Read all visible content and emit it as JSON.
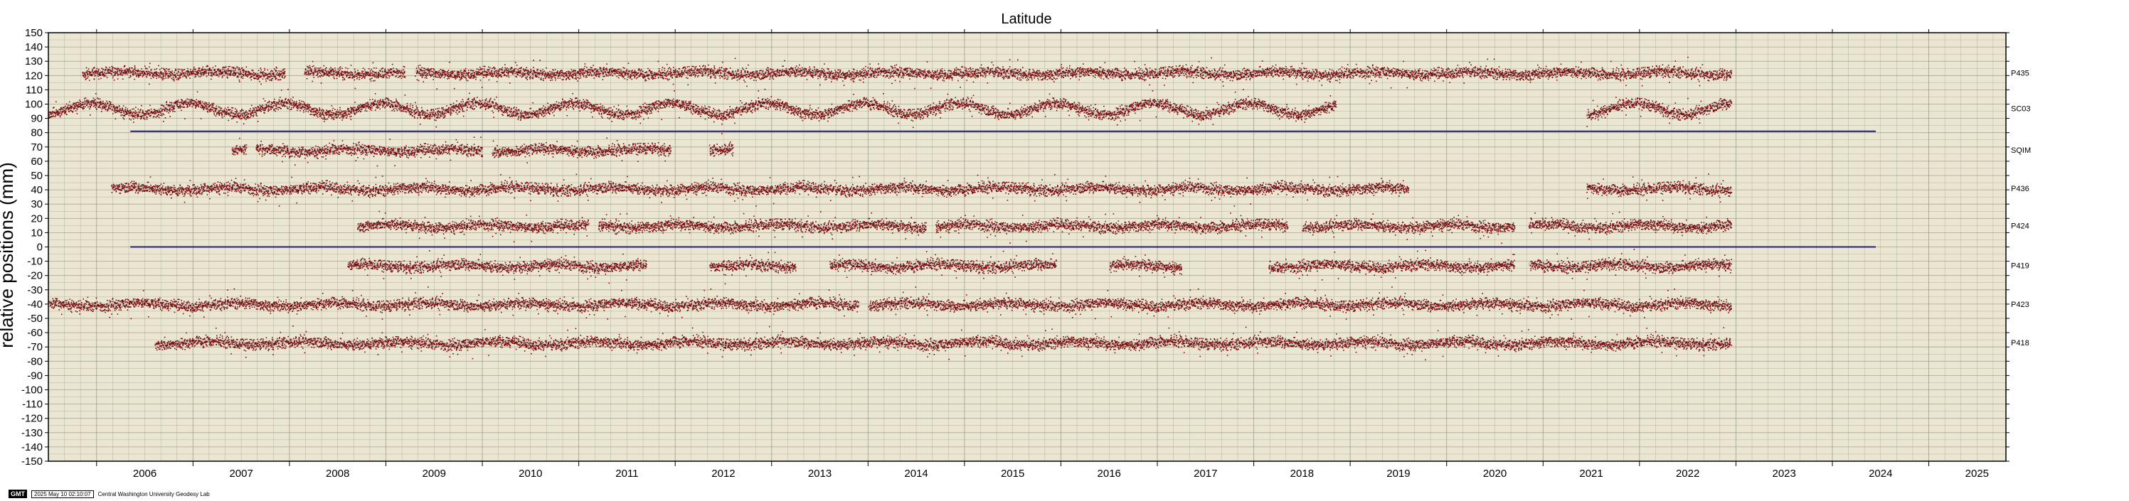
{
  "footer": {
    "badge": "GMT",
    "timestamp": "2025 May 10 02:10:07",
    "credit": "Central Washington University Geodesy Lab"
  },
  "colors": {
    "background": "#ebe6d2",
    "grid": "#8c8c7a",
    "points": "#7a0a0a",
    "reference_line": "#1f1f7a",
    "error_band": "#b4b4b4"
  },
  "chart_data": {
    "type": "scatter",
    "title": "Latitude",
    "xlabel": "",
    "ylabel": "relative positions (mm)",
    "xlim": [
      2005.5,
      2025.8
    ],
    "ylim": [
      -150,
      150
    ],
    "grid": true,
    "x_ticks": [
      "2006",
      "2007",
      "2008",
      "2009",
      "2010",
      "2011",
      "2012",
      "2013",
      "2014",
      "2015",
      "2016",
      "2017",
      "2018",
      "2019",
      "2020",
      "2021",
      "2022",
      "2023",
      "2024",
      "2025"
    ],
    "y_ticks": [
      150,
      140,
      130,
      120,
      110,
      100,
      90,
      80,
      70,
      60,
      50,
      40,
      30,
      20,
      10,
      0,
      -10,
      -20,
      -30,
      -40,
      -50,
      -60,
      -70,
      -80,
      -90,
      -100,
      -110,
      -120,
      -130,
      -140,
      -150
    ],
    "reference_lines": [
      {
        "y": 81,
        "x_start": 2006.35,
        "x_end": 2024.45
      },
      {
        "y": 0,
        "x_start": 2006.35,
        "x_end": 2024.45
      }
    ],
    "series": [
      {
        "name": "P435",
        "offset": 122,
        "segments": [
          [
            2005.85,
            2007.95
          ],
          [
            2008.15,
            2009.2
          ],
          [
            2009.3,
            2022.95
          ]
        ]
      },
      {
        "name": "SC03",
        "offset": 97,
        "segments": [
          [
            2005.5,
            2018.85
          ],
          [
            2021.45,
            2022.95
          ]
        ]
      },
      {
        "name": "SQIM",
        "offset": 68,
        "segments": [
          [
            2007.4,
            2007.55
          ],
          [
            2007.65,
            2010.0
          ],
          [
            2010.1,
            2011.95
          ],
          [
            2012.35,
            2012.6
          ]
        ]
      },
      {
        "name": "P436",
        "offset": 41,
        "segments": [
          [
            2006.15,
            2019.6
          ],
          [
            2021.45,
            2022.95
          ]
        ]
      },
      {
        "name": "P424",
        "offset": 15,
        "segments": [
          [
            2008.7,
            2011.1
          ],
          [
            2011.2,
            2014.6
          ],
          [
            2014.7,
            2018.35
          ],
          [
            2018.5,
            2020.7
          ],
          [
            2020.85,
            2022.95
          ]
        ]
      },
      {
        "name": "P419",
        "offset": -13,
        "segments": [
          [
            2008.6,
            2011.7
          ],
          [
            2012.35,
            2013.25
          ],
          [
            2013.6,
            2015.95
          ],
          [
            2016.5,
            2017.25
          ],
          [
            2018.15,
            2020.7
          ],
          [
            2020.85,
            2022.95
          ]
        ]
      },
      {
        "name": "P423",
        "offset": -40,
        "segments": [
          [
            2005.5,
            2013.9
          ],
          [
            2014.0,
            2022.95
          ]
        ]
      },
      {
        "name": "P418",
        "offset": -67,
        "segments": [
          [
            2006.6,
            2022.95
          ]
        ]
      }
    ]
  }
}
